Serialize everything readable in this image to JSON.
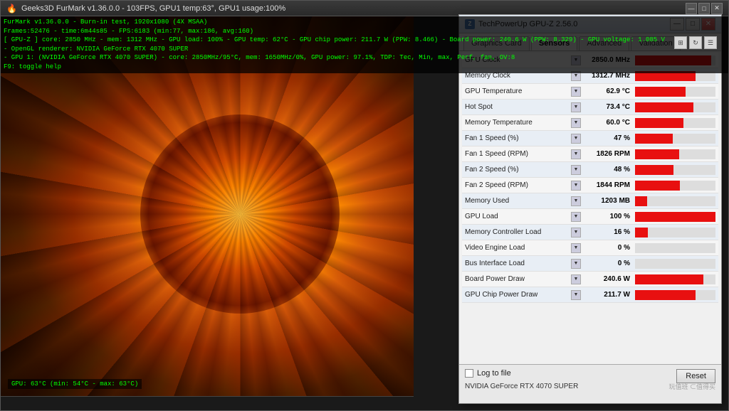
{
  "furmark": {
    "title": "Geeks3D FurMark v1.36.0.0 - 103FPS, GPU1 temp:63°, GPU1 usage:100%",
    "info_lines": [
      "FurMark v1.36.0.0 - Burn-in test, 1920x1080 (4X MSAA)",
      "Frames:52476 - time:6m44s85 - FPS:6183 (min:77, max:186, avg:160)",
      "[ GPU-Z ] core: 2850 MHz - mem: 1312 MHz - GPU load: 100% - GPU temp: 62°C - GPU chip power: 211.7 W (PPW: 8.466) - Board power: 240.6 W (PPW: 8.329) - GPU voltage: 1.085 V",
      "- OpenGL renderer: NVIDIA GeForce RTX 4070 SUPER",
      "- GPU 1: (NVIDIA GeForce RTX 4070 SUPER) - core: 2850MHz/95°C, mem: 1650MHz/0%, GPU power: 97.1%, TDP: Tec, Min, max, Perf, fan, OV:8",
      "F9: toggle help"
    ],
    "temp_overlay": "GPU: 63°C (min: 54°C - max: 63°C)",
    "statusbar": ""
  },
  "gpuz": {
    "title": "TechPowerUp GPU-Z 2.56.0",
    "tabs": [
      "Graphics Card",
      "Sensors",
      "Advanced",
      "Validation"
    ],
    "active_tab": "Sensors",
    "toolbar_icons": [
      "grid-icon",
      "refresh-icon",
      "menu-icon"
    ],
    "sensors": [
      {
        "name": "GPU Clock",
        "value": "2850.0 MHz",
        "bar_pct": 95
      },
      {
        "name": "Memory Clock",
        "value": "1312.7 MHz",
        "bar_pct": 75
      },
      {
        "name": "GPU Temperature",
        "value": "62.9 °C",
        "bar_pct": 63
      },
      {
        "name": "Hot Spot",
        "value": "73.4 °C",
        "bar_pct": 73
      },
      {
        "name": "Memory Temperature",
        "value": "60.0 °C",
        "bar_pct": 60
      },
      {
        "name": "Fan 1 Speed (%)",
        "value": "47 %",
        "bar_pct": 47
      },
      {
        "name": "Fan 1 Speed (RPM)",
        "value": "1826 RPM",
        "bar_pct": 55
      },
      {
        "name": "Fan 2 Speed (%)",
        "value": "48 %",
        "bar_pct": 48
      },
      {
        "name": "Fan 2 Speed (RPM)",
        "value": "1844 RPM",
        "bar_pct": 56
      },
      {
        "name": "Memory Used",
        "value": "1203 MB",
        "bar_pct": 15
      },
      {
        "name": "GPU Load",
        "value": "100 %",
        "bar_pct": 100
      },
      {
        "name": "Memory Controller Load",
        "value": "16 %",
        "bar_pct": 16
      },
      {
        "name": "Video Engine Load",
        "value": "0 %",
        "bar_pct": 0
      },
      {
        "name": "Bus Interface Load",
        "value": "0 %",
        "bar_pct": 0
      },
      {
        "name": "Board Power Draw",
        "value": "240.6 W",
        "bar_pct": 85
      },
      {
        "name": "GPU Chip Power Draw",
        "value": "211.7 W",
        "bar_pct": 75
      }
    ],
    "log_label": "Log to file",
    "reset_label": "Reset",
    "card_name": "NVIDIA GeForce RTX 4070 SUPER"
  }
}
